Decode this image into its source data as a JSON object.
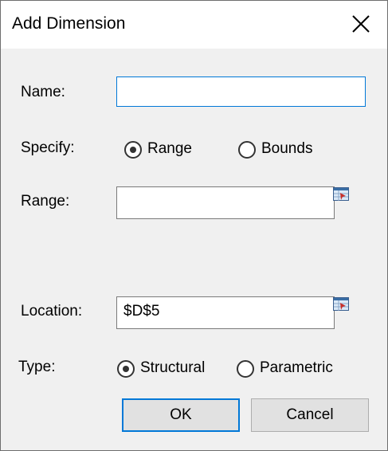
{
  "dialog": {
    "title": "Add Dimension",
    "close_icon": "close-icon"
  },
  "fields": {
    "name_label": "Name:",
    "name_value": "",
    "specify_label": "Specify:",
    "specify_options": [
      "Range",
      "Bounds"
    ],
    "specify_selected": "Range",
    "range_label": "Range:",
    "range_value": "",
    "location_label": "Location:",
    "location_value": "$D$5",
    "type_label": "Type:",
    "type_options": [
      "Structural",
      "Parametric"
    ],
    "type_selected": "Structural",
    "picker_icon": "range-picker-icon"
  },
  "buttons": {
    "ok": "OK",
    "cancel": "Cancel"
  },
  "colors": {
    "focus": "#0078d7",
    "background": "#f0f0f0"
  }
}
